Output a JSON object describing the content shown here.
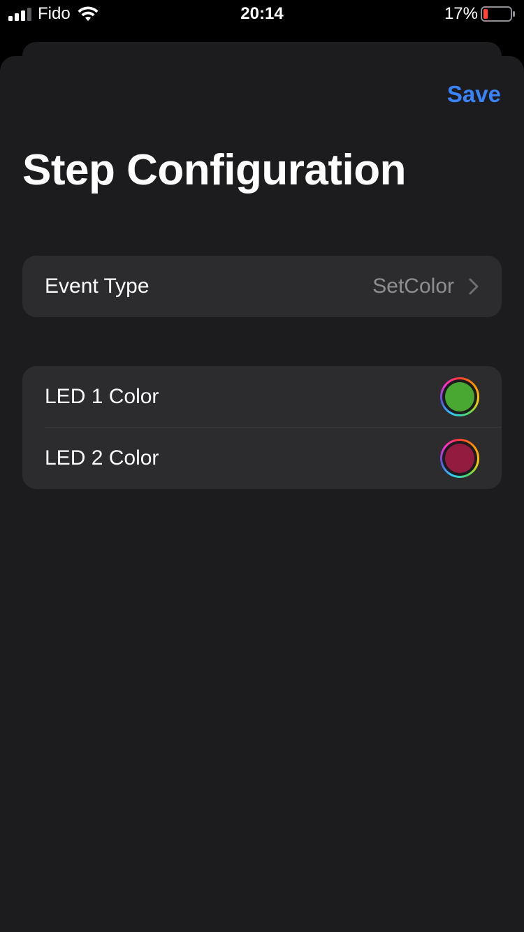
{
  "status_bar": {
    "carrier": "Fido",
    "time": "20:14",
    "battery_percent": "17%",
    "battery_level": 0.17,
    "signal_bars": 3
  },
  "nav": {
    "save_label": "Save"
  },
  "title": "Step Configuration",
  "event_group": {
    "label": "Event Type",
    "value": "SetColor"
  },
  "led_group": {
    "items": [
      {
        "label": "LED 1 Color",
        "color": "#48a832"
      },
      {
        "label": "LED 2 Color",
        "color": "#931b40"
      }
    ]
  },
  "colors": {
    "accent": "#3a82f7",
    "battery_low": "#ff453a"
  }
}
